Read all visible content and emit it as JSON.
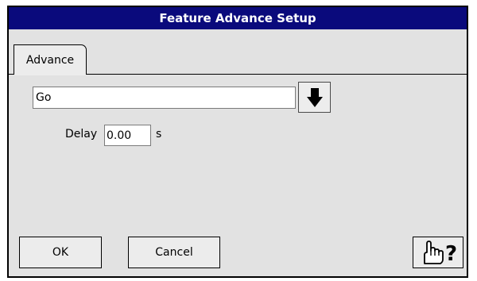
{
  "window": {
    "title": "Feature Advance Setup"
  },
  "tabs": [
    {
      "label": "Advance",
      "active": true
    }
  ],
  "action_select": {
    "value": "Go",
    "dropdown_icon": "arrow-down-icon"
  },
  "delay": {
    "label": "Delay",
    "value": "0.00",
    "unit": "s"
  },
  "buttons": {
    "ok": "OK",
    "cancel": "Cancel",
    "help_icon": "hand-pointer-question-icon"
  },
  "colors": {
    "titlebar": "#0a0a7c",
    "panel": "#e2e2e2",
    "button": "#ececec"
  }
}
